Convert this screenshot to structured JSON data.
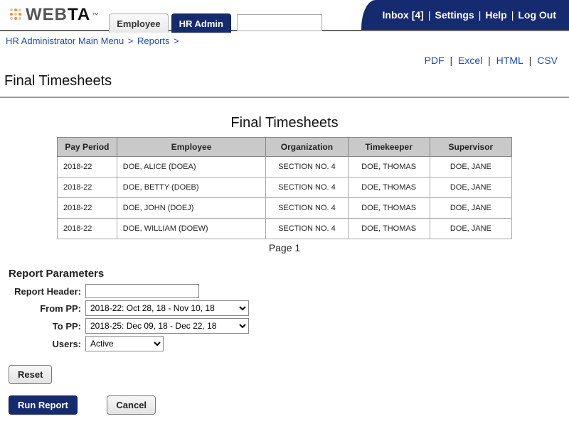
{
  "logo": {
    "text_light": "WEB",
    "text_bold": "TA",
    "tm": "™"
  },
  "tabs": {
    "employee": "Employee",
    "hr_admin": "HR Admin",
    "search_value": ""
  },
  "topnav": {
    "inbox": "Inbox [4]",
    "settings": "Settings",
    "help": "Help",
    "logout": "Log Out"
  },
  "breadcrumb": {
    "item1": "HR Administrator Main Menu",
    "item2": "Reports"
  },
  "export": {
    "pdf": "PDF",
    "excel": "Excel",
    "html": "HTML",
    "csv": "CSV"
  },
  "page_title": "Final Timesheets",
  "report": {
    "title": "Final Timesheets",
    "columns": {
      "c0": "Pay Period",
      "c1": "Employee",
      "c2": "Organization",
      "c3": "Timekeeper",
      "c4": "Supervisor"
    },
    "rows": [
      {
        "pp": "2018-22",
        "emp": "DOE, ALICE (DOEA)",
        "org": "SECTION NO. 4",
        "tk": "DOE, THOMAS",
        "sup": "DOE, JANE"
      },
      {
        "pp": "2018-22",
        "emp": "DOE, BETTY (DOEB)",
        "org": "SECTION NO. 4",
        "tk": "DOE, THOMAS",
        "sup": "DOE, JANE"
      },
      {
        "pp": "2018-22",
        "emp": "DOE, JOHN (DOEJ)",
        "org": "SECTION NO. 4",
        "tk": "DOE, THOMAS",
        "sup": "DOE, JANE"
      },
      {
        "pp": "2018-22",
        "emp": "DOE, WILLIAM (DOEW)",
        "org": "SECTION NO. 4",
        "tk": "DOE, THOMAS",
        "sup": "DOE, JANE"
      }
    ],
    "pager": "Page 1"
  },
  "params": {
    "heading": "Report Parameters",
    "labels": {
      "header": "Report Header:",
      "from": "From PP:",
      "to": "To PP:",
      "users": "Users:"
    },
    "report_header_value": "",
    "from_pp": "2018-22: Oct 28, 18 - Nov 10, 18",
    "to_pp": "2018-25: Dec 09, 18 - Dec 22, 18",
    "users": "Active"
  },
  "buttons": {
    "reset": "Reset",
    "run": "Run Report",
    "cancel": "Cancel"
  }
}
